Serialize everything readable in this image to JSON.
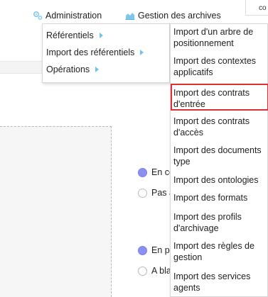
{
  "nav": {
    "admin_label": "Administration",
    "archives_label": "Gestion des archives",
    "user_text": "co"
  },
  "menu1": {
    "items": [
      {
        "label": "Référentiels"
      },
      {
        "label": "Import des référentiels"
      },
      {
        "label": "Opérations"
      }
    ]
  },
  "menu2": {
    "items": [
      {
        "label": "Import d'un arbre de positionnement"
      },
      {
        "label": "Import des contextes applicatifs"
      },
      {
        "label": "Import des contrats d'entrée",
        "highlighted": true
      },
      {
        "label": "Import des contrats d'accès"
      },
      {
        "label": "Import des documents type"
      },
      {
        "label": "Import des ontologies"
      },
      {
        "label": "Import des formats"
      },
      {
        "label": "Import des profils d'archivage"
      },
      {
        "label": "Import des règles de gestion"
      },
      {
        "label": "Import des services agents"
      }
    ]
  },
  "background": {
    "radios": [
      {
        "label": "En co",
        "selected": true
      },
      {
        "label": "Pas à",
        "selected": false
      },
      {
        "label": "En pr",
        "selected": true
      },
      {
        "label": "A blai",
        "selected": false
      }
    ]
  },
  "colors": {
    "accent_arrow": "#6ec3ee",
    "highlight_border": "#d9333a",
    "radio_selected": "#8a8ff0"
  }
}
